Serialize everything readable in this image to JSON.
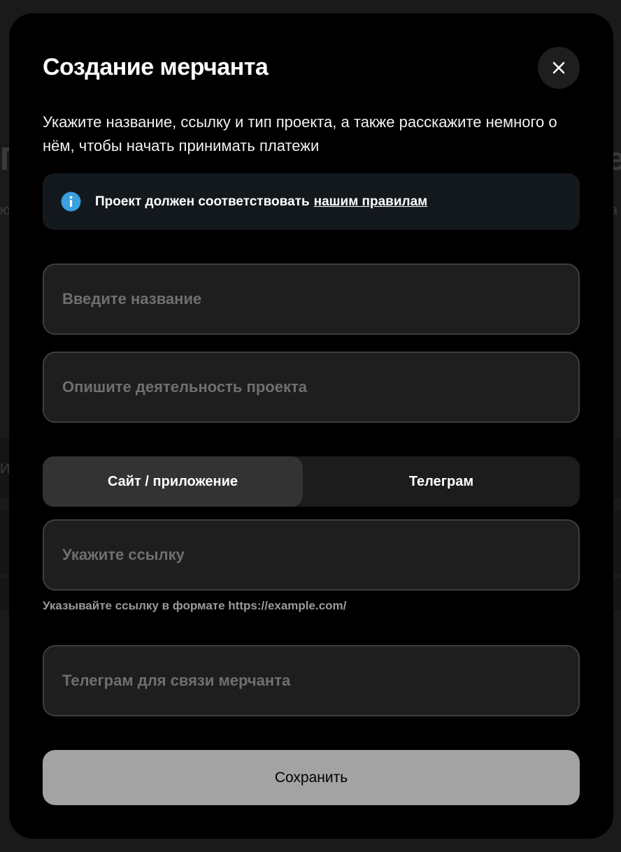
{
  "background": {
    "fragments": [
      "П",
      "е",
      "ю",
      "а",
      "И"
    ]
  },
  "modal": {
    "title": "Создание мерчанта",
    "close_icon": "close-icon",
    "subtitle": "Укажите название, ссылку и тип проекта, а также расскажите немного о нём, чтобы начать принимать платежи",
    "notice": {
      "icon": "info-icon",
      "text": "Проект должен соответствовать",
      "link_text": "нашим правилам",
      "accent_color": "#3aa0e0"
    },
    "fields": {
      "name_placeholder": "Введите название",
      "description_placeholder": "Опишите деятельность проекта",
      "link_placeholder": "Укажите ссылку",
      "telegram_placeholder": "Телеграм для связи мерчанта"
    },
    "type_tabs": [
      {
        "label": "Сайт / приложение",
        "selected": true
      },
      {
        "label": "Телеграм",
        "selected": false
      }
    ],
    "link_hint": "Указывайте ссылку в формате https://example.com/",
    "save_label": "Сохранить"
  }
}
